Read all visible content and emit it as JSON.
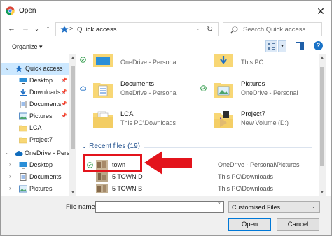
{
  "window": {
    "title": "Open",
    "close_glyph": "✕"
  },
  "nav": {
    "back_glyph": "←",
    "forward_glyph": "→",
    "dropdown_glyph": "⌄",
    "up_glyph": "↑",
    "address": {
      "separator": ">",
      "location": "Quick access",
      "chevron": "⌄",
      "refresh_glyph": "↻"
    },
    "search": {
      "placeholder": "Search Quick access"
    }
  },
  "toolbar": {
    "organize_label": "Organize ▾",
    "view_dropdown": "▾",
    "help_glyph": "?"
  },
  "sidebar": {
    "quick_access": {
      "label": "Quick access",
      "arrow": "⌄"
    },
    "quick_items": [
      {
        "label": "Desktop",
        "icon": "desktop-icon",
        "pinned": "📌"
      },
      {
        "label": "Downloads",
        "icon": "downloads-icon",
        "pinned": "📌"
      },
      {
        "label": "Documents",
        "icon": "documents-icon",
        "pinned": "📌"
      },
      {
        "label": "Pictures",
        "icon": "pictures-icon",
        "pinned": "📌"
      },
      {
        "label": "LCA",
        "icon": "folder-icon"
      },
      {
        "label": "Project7",
        "icon": "folder-icon"
      }
    ],
    "onedrive": {
      "label": "OneDrive - Perso",
      "arrow": "⌄"
    },
    "onedrive_items": [
      {
        "label": "Desktop",
        "arrow": "›"
      },
      {
        "label": "Documents",
        "arrow": "›"
      },
      {
        "label": "Pictures",
        "arrow": "›"
      }
    ]
  },
  "folders": [
    {
      "name": "",
      "location": "OneDrive - Personal",
      "status": "synced"
    },
    {
      "name": "",
      "location": "This PC",
      "status": "none"
    },
    {
      "name": "Documents",
      "location": "OneDrive - Personal",
      "status": "cloud"
    },
    {
      "name": "Pictures",
      "location": "OneDrive - Personal",
      "status": "synced"
    },
    {
      "name": "LCA",
      "location": "This PC\\Downloads",
      "status": "none"
    },
    {
      "name": "Project7",
      "location": "New Volume (D:)",
      "status": "none"
    }
  ],
  "recent": {
    "heading": "⌄ Recent files (19)",
    "files": [
      {
        "name": "town",
        "path": "OneDrive - Personal\\Pictures",
        "status": "synced"
      },
      {
        "name": "5 TOWN D",
        "path": "This PC\\Downloads"
      },
      {
        "name": "5 TOWN B",
        "path": "This PC\\Downloads"
      }
    ]
  },
  "scroll": {
    "up": "▲",
    "down": "▼"
  },
  "footer": {
    "file_name_label": "File name:",
    "file_name_value": "",
    "file_name_dropdown": "⌄",
    "file_type": "Customised Files",
    "file_type_chev": "⌄",
    "open_label": "Open",
    "cancel_label": "Cancel"
  },
  "colors": {
    "accent": "#0078d7",
    "highlight_red": "#e3141c",
    "selection": "#cce8ff",
    "folder_yellow": "#f8d775"
  }
}
